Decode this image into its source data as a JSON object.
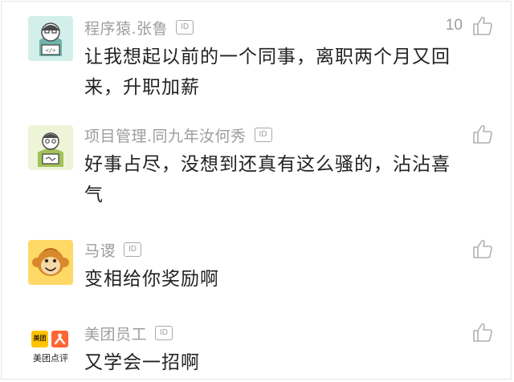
{
  "comments": [
    {
      "username": "程序猿.张鲁",
      "id_badge": "ID",
      "text": "让我想起以前的一个同事，离职两个月又回来，升职加薪",
      "like_count": "10",
      "avatar": "programmer-avatar-icon"
    },
    {
      "username": "项目管理.同九年汝何秀",
      "id_badge": "ID",
      "text": "好事占尽，没想到还真有这么骚的，沾沾喜气",
      "like_count": "",
      "avatar": "project-manager-avatar-icon"
    },
    {
      "username": "马谡",
      "id_badge": "ID",
      "text": "变相给你奖励啊",
      "like_count": "",
      "avatar": "monkey-avatar-icon"
    },
    {
      "username": "美团员工",
      "id_badge": "ID",
      "text": "又学会一招啊",
      "like_count": "",
      "avatar": "meituan-avatar-icon",
      "avatar_labels": [
        "美团",
        "美团点评"
      ]
    }
  ],
  "colors": {
    "username": "#9d9d9d",
    "text": "#222222",
    "accent_green": "#8cc63f",
    "meituan_yellow": "#ffc300",
    "dianping_orange": "#ff6633"
  }
}
